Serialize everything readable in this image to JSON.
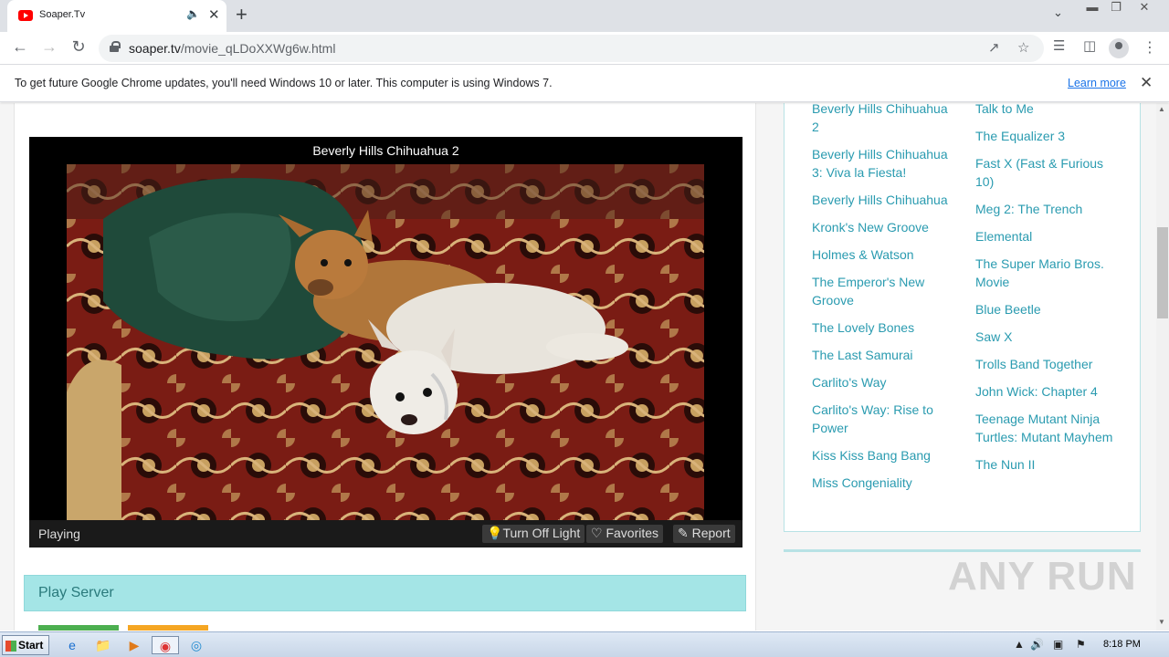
{
  "browser": {
    "tab_title": "Soaper.Tv",
    "url_host": "soaper.tv",
    "url_path": "/movie_qLDoXXWg6w.html"
  },
  "infobar": {
    "message": "To get future Google Chrome updates, you'll need Windows 10 or later. This computer is using Windows 7.",
    "learn_more": "Learn more"
  },
  "player": {
    "title": "Beverly Hills Chihuahua 2",
    "status": "Playing",
    "turn_off_light": "Turn Off Light",
    "favorites": "Favorites",
    "report": "Report"
  },
  "play_server": {
    "label": "Play Server"
  },
  "sidebar": {
    "left": [
      "Beverly Hills Chihuahua 2",
      "Beverly Hills Chihuahua 3: Viva la Fiesta!",
      "Beverly Hills Chihuahua",
      "Kronk's New Groove",
      "Holmes & Watson",
      "The Emperor's New Groove",
      "The Lovely Bones",
      "The Last Samurai",
      "Carlito's Way",
      "Carlito's Way: Rise to Power",
      "Kiss Kiss Bang Bang",
      "Miss Congeniality"
    ],
    "right": [
      "Talk to Me",
      "The Equalizer 3",
      "Fast X (Fast & Furious 10)",
      "Meg 2: The Trench",
      "Elemental",
      "The Super Mario Bros. Movie",
      "Blue Beetle",
      "Saw X",
      "Trolls Band Together",
      "John Wick: Chapter 4",
      "Teenage Mutant Ninja Turtles: Mutant Mayhem",
      "The Nun II"
    ]
  },
  "watermark": "ANY RUN",
  "taskbar": {
    "start": "Start",
    "clock": "8:18 PM"
  },
  "colors": {
    "link": "#2a9bb0",
    "server_bar": "#a4e5e6",
    "play_green": "#4caf50",
    "play_orange": "#f5a623"
  }
}
